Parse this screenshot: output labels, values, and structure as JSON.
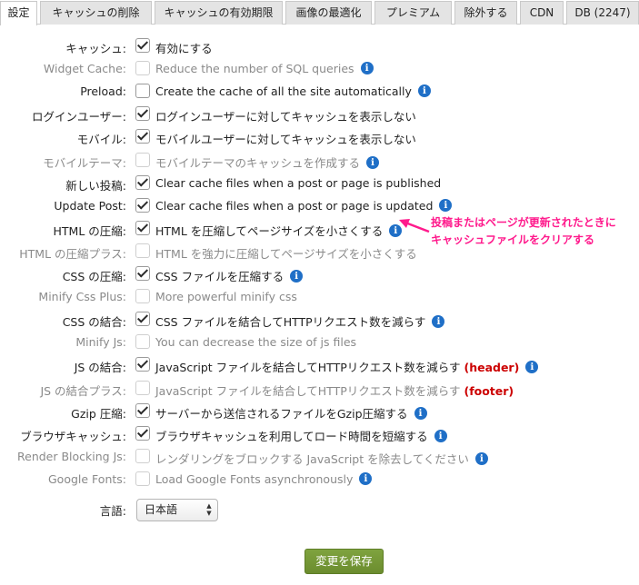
{
  "tabs": [
    {
      "label": "設定",
      "active": true
    },
    {
      "label": "キャッシュの削除"
    },
    {
      "label": "キャッシュの有効期限"
    },
    {
      "label": "画像の最適化"
    },
    {
      "label": "プレミアム"
    },
    {
      "label": "除外する"
    },
    {
      "label": "CDN"
    },
    {
      "label": "DB (2247)"
    }
  ],
  "settings": [
    {
      "label": "キャッシュ:",
      "desc": "有効にする",
      "checked": true,
      "disabled": false,
      "info": false
    },
    {
      "label": "Widget Cache:",
      "desc": "Reduce the number of SQL queries",
      "checked": false,
      "disabled": true,
      "info": true
    },
    {
      "label": "Preload:",
      "desc": "Create the cache of all the site automatically",
      "checked": false,
      "disabled": false,
      "info": true
    },
    {
      "label": "ログインユーザー:",
      "desc": "ログインユーザーに対してキャッシュを表示しない",
      "checked": true,
      "disabled": false,
      "info": false
    },
    {
      "label": "モバイル:",
      "desc": "モバイルユーザーに対してキャッシュを表示しない",
      "checked": true,
      "disabled": false,
      "info": false
    },
    {
      "label": "モバイルテーマ:",
      "desc": "モバイルテーマのキャッシュを作成する",
      "checked": false,
      "disabled": true,
      "info": true
    },
    {
      "label": "新しい投稿:",
      "desc": "Clear cache files when a post or page is published",
      "checked": true,
      "disabled": false,
      "info": false
    },
    {
      "label": "Update Post:",
      "desc": "Clear cache files when a post or page is updated",
      "checked": true,
      "disabled": false,
      "info": true
    },
    {
      "label": "HTML の圧縮:",
      "desc": "HTML を圧縮してページサイズを小さくする",
      "checked": true,
      "disabled": false,
      "info": true
    },
    {
      "label": "HTML の圧縮プラス:",
      "desc": "HTML を強力に圧縮してページサイズを小さくする",
      "checked": false,
      "disabled": true,
      "info": false
    },
    {
      "label": "CSS の圧縮:",
      "desc": "CSS ファイルを圧縮する",
      "checked": true,
      "disabled": false,
      "info": true
    },
    {
      "label": "Minify Css Plus:",
      "desc": "More powerful minify css",
      "checked": false,
      "disabled": true,
      "info": false
    },
    {
      "label": "CSS の結合:",
      "desc": "CSS ファイルを結合してHTTPリクエスト数を減らす",
      "checked": true,
      "disabled": false,
      "info": true
    },
    {
      "label": "Minify Js:",
      "desc": "You can decrease the size of js files",
      "checked": false,
      "disabled": true,
      "info": false
    },
    {
      "label": "JS の結合:",
      "desc": "JavaScript ファイルを結合してHTTPリクエスト数を減らす",
      "tag": "(header)",
      "checked": true,
      "disabled": false,
      "info": true
    },
    {
      "label": "JS の結合プラス:",
      "desc": "JavaScript ファイルを結合してHTTPリクエスト数を減らす",
      "tag": "(footer)",
      "checked": false,
      "disabled": true,
      "info": false
    },
    {
      "label": "Gzip 圧縮:",
      "desc": "サーバーから送信されるファイルをGzip圧縮する",
      "checked": true,
      "disabled": false,
      "info": true
    },
    {
      "label": "ブラウザキャッシュ:",
      "desc": "ブラウザキャッシュを利用してロード時間を短縮する",
      "checked": true,
      "disabled": false,
      "info": true
    },
    {
      "label": "Render Blocking Js:",
      "desc": "レンダリングをブロックする JavaScript を除去してください",
      "checked": false,
      "disabled": true,
      "info": true
    },
    {
      "label": "Google Fonts:",
      "desc": "Load Google Fonts asynchronously",
      "checked": false,
      "disabled": true,
      "info": true
    }
  ],
  "language": {
    "label": "言語:",
    "value": "日本語"
  },
  "save_label": "変更を保存",
  "annotation": {
    "line1": "投稿またはページが更新されたときに",
    "line2": "キャッシュファイルをクリアする",
    "color": "#ff1a8c"
  },
  "icons": {
    "info": "info-icon",
    "check": "checkmark-icon",
    "select": "select-arrows-icon"
  }
}
